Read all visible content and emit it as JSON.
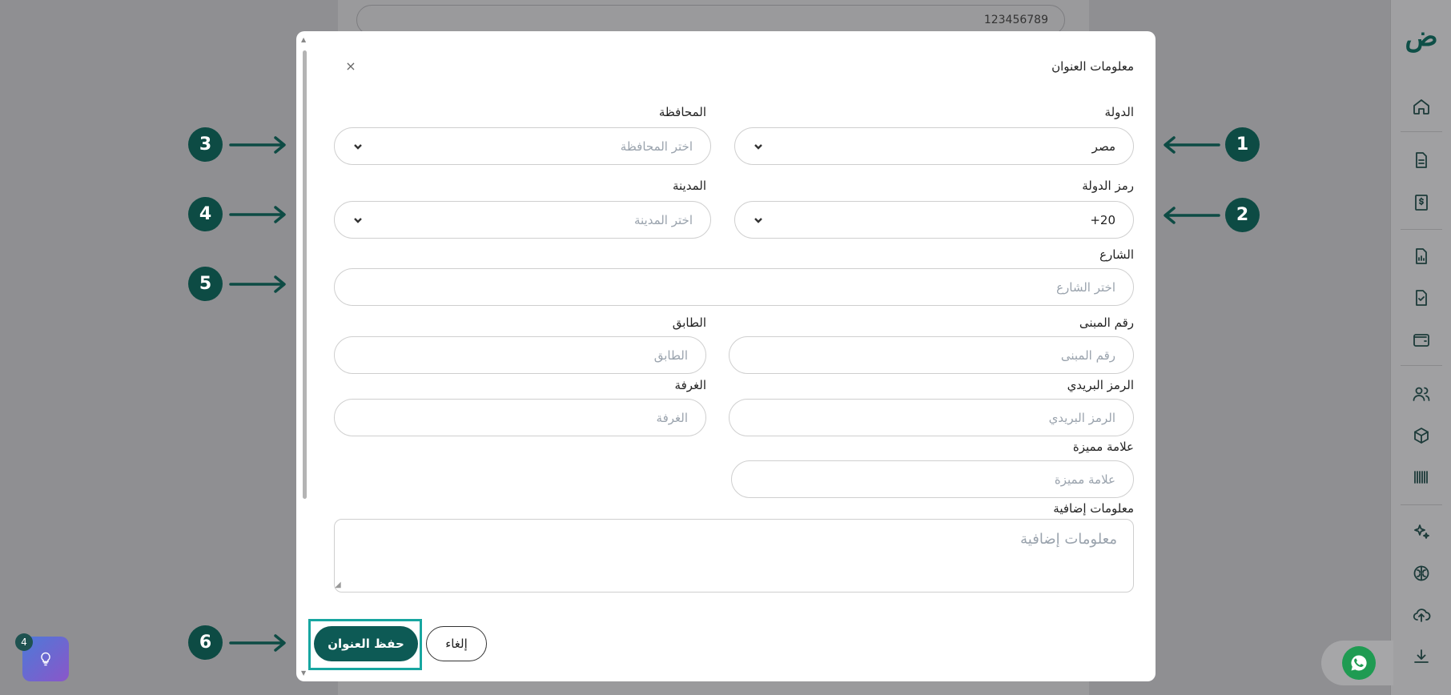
{
  "background": {
    "phone_value": "123456789"
  },
  "modal": {
    "title": "معلومات العنوان",
    "close_label": "×",
    "country": {
      "label": "الدولة",
      "value": "مصر"
    },
    "governorate": {
      "label": "المحافظة",
      "placeholder": "اختر المحافظة"
    },
    "country_code": {
      "label": "رمز الدولة",
      "value": "+20"
    },
    "city": {
      "label": "المدينة",
      "placeholder": "اختر المدينة"
    },
    "street": {
      "label": "الشارع",
      "placeholder": "اختر الشارع"
    },
    "building_number": {
      "label": "رقم المبنى",
      "placeholder": "رقم المبنى"
    },
    "floor": {
      "label": "الطابق",
      "placeholder": "الطابق"
    },
    "postal_code": {
      "label": "الرمز البريدي",
      "placeholder": "الرمز البريدي"
    },
    "room": {
      "label": "الغرفة",
      "placeholder": "الغرفة"
    },
    "landmark": {
      "label": "علامة مميزة",
      "placeholder": "علامة مميزة"
    },
    "additional_info": {
      "label": "معلومات إضافية",
      "placeholder": "معلومات إضافية"
    },
    "save_label": "حفظ العنوان",
    "cancel_label": "إلغاء"
  },
  "callouts": [
    "1",
    "2",
    "3",
    "4",
    "5",
    "6"
  ],
  "widgets": {
    "hint_count": "4"
  },
  "sidebar": {
    "logo": "ض",
    "icons": [
      "home-icon",
      "document-icon",
      "invoice-dollar-icon",
      "report-icon",
      "checklist-icon",
      "wallet-icon",
      "users-icon",
      "package-icon",
      "barcode-icon",
      "sparkles-icon",
      "brain-icon",
      "cloud-upload-icon",
      "download-icon"
    ]
  },
  "colors": {
    "accent": "#0d5a55",
    "badge": "#0d4b44",
    "highlight": "#17a6a0",
    "overlay": "#8f8f92"
  }
}
